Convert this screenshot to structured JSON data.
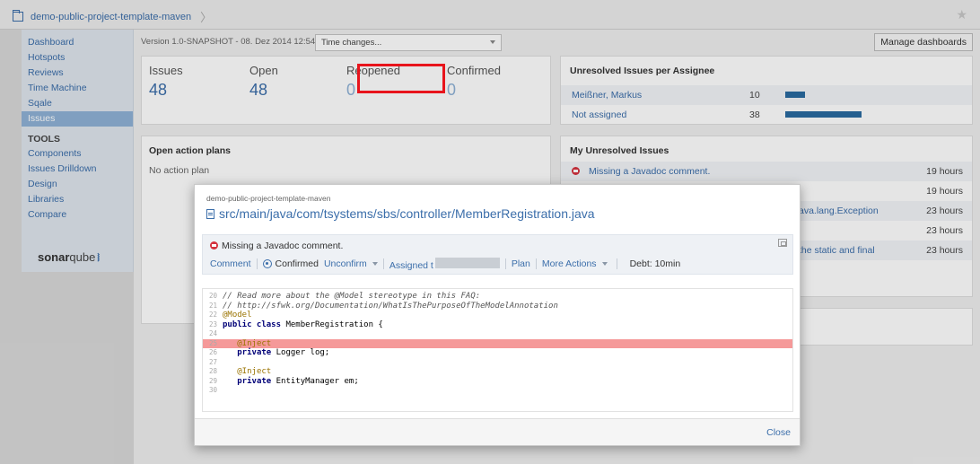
{
  "topbar": {
    "project": "demo-public-project-template-maven"
  },
  "sidebar": {
    "items": [
      {
        "label": "Dashboard"
      },
      {
        "label": "Hotspots"
      },
      {
        "label": "Reviews"
      },
      {
        "label": "Time Machine"
      },
      {
        "label": "Sqale"
      },
      {
        "label": "Issues"
      }
    ],
    "tools_heading": "TOOLS",
    "tools": [
      {
        "label": "Components"
      },
      {
        "label": "Issues Drilldown"
      },
      {
        "label": "Design"
      },
      {
        "label": "Libraries"
      },
      {
        "label": "Compare"
      }
    ],
    "logo": {
      "text_bold": "sonar",
      "text_light": "qube"
    }
  },
  "header": {
    "version_line": "Version 1.0-SNAPSHOT - 08. Dez 2014 12:54",
    "time_changes": "Time changes...",
    "manage_dashboards": "Manage dashboards"
  },
  "issues_widget": {
    "metrics": [
      {
        "label": "Issues",
        "value": "48"
      },
      {
        "label": "Open",
        "value": "48"
      },
      {
        "label": "Reopened",
        "value": "0"
      },
      {
        "label": "Confirmed",
        "value": "0"
      }
    ]
  },
  "assignee_widget": {
    "title": "Unresolved Issues per Assignee",
    "rows": [
      {
        "name": "Meißner, Markus",
        "count": "10",
        "fraction": 0.26
      },
      {
        "name": "Not assigned",
        "count": "38",
        "fraction": 1.0
      }
    ]
  },
  "plans_widget": {
    "title": "Open action plans",
    "empty": "No action plan"
  },
  "my_issues_widget": {
    "title": "My Unresolved Issues",
    "rows": [
      {
        "text": "Missing a Javadoc comment.",
        "time": "19 hours"
      },
      {
        "text": "",
        "time": "19 hours"
      },
      {
        "text": "ava.lang.Exception",
        "time": "23 hours"
      },
      {
        "text": "",
        "time": "23 hours"
      },
      {
        "text": "the static and final",
        "time": "23 hours"
      }
    ]
  },
  "modal": {
    "project": "demo-public-project-template-maven",
    "file": "src/main/java/com/tsystems/sbs/controller/MemberRegistration.java",
    "issue_title": "Missing a Javadoc comment.",
    "actions": {
      "comment": "Comment",
      "status": "Confirmed",
      "unconfirm": "Unconfirm",
      "assigned": "Assigned t",
      "plan": "Plan",
      "more_actions": "More Actions",
      "debt": "Debt: 10min"
    },
    "code": [
      {
        "n": "20",
        "parts": [
          {
            "c": "cm",
            "t": "// Read more about the @Model stereotype in this FAQ:"
          }
        ]
      },
      {
        "n": "21",
        "parts": [
          {
            "c": "cm",
            "t": "// http://sfwk.org/Documentation/WhatIsThePurposeOfTheModelAnnotation"
          }
        ]
      },
      {
        "n": "22",
        "parts": [
          {
            "c": "an",
            "t": "@Model"
          }
        ]
      },
      {
        "n": "23",
        "parts": [
          {
            "c": "kw",
            "t": "public class"
          },
          {
            "c": "tx",
            "t": " MemberRegistration {"
          }
        ]
      },
      {
        "n": "24",
        "parts": []
      },
      {
        "n": "25",
        "hl": true,
        "parts": [
          {
            "c": "tx",
            "t": "   "
          },
          {
            "c": "an",
            "t": "@Inject"
          }
        ]
      },
      {
        "n": "26",
        "parts": [
          {
            "c": "tx",
            "t": "   "
          },
          {
            "c": "kw",
            "t": "private"
          },
          {
            "c": "tx",
            "t": " Logger log;"
          }
        ]
      },
      {
        "n": "27",
        "parts": []
      },
      {
        "n": "28",
        "parts": [
          {
            "c": "tx",
            "t": "   "
          },
          {
            "c": "an",
            "t": "@Inject"
          }
        ]
      },
      {
        "n": "29",
        "parts": [
          {
            "c": "tx",
            "t": "   "
          },
          {
            "c": "kw",
            "t": "private"
          },
          {
            "c": "tx",
            "t": " EntityManager em;"
          }
        ]
      },
      {
        "n": "30",
        "parts": []
      }
    ],
    "close": "Close"
  },
  "colors": {
    "link": "#3b6eaa",
    "active_nav": "#8fb2d6",
    "bar": "#2a6aa0",
    "highlight_line": "#f59999",
    "annotation_box": "#e8141c"
  }
}
